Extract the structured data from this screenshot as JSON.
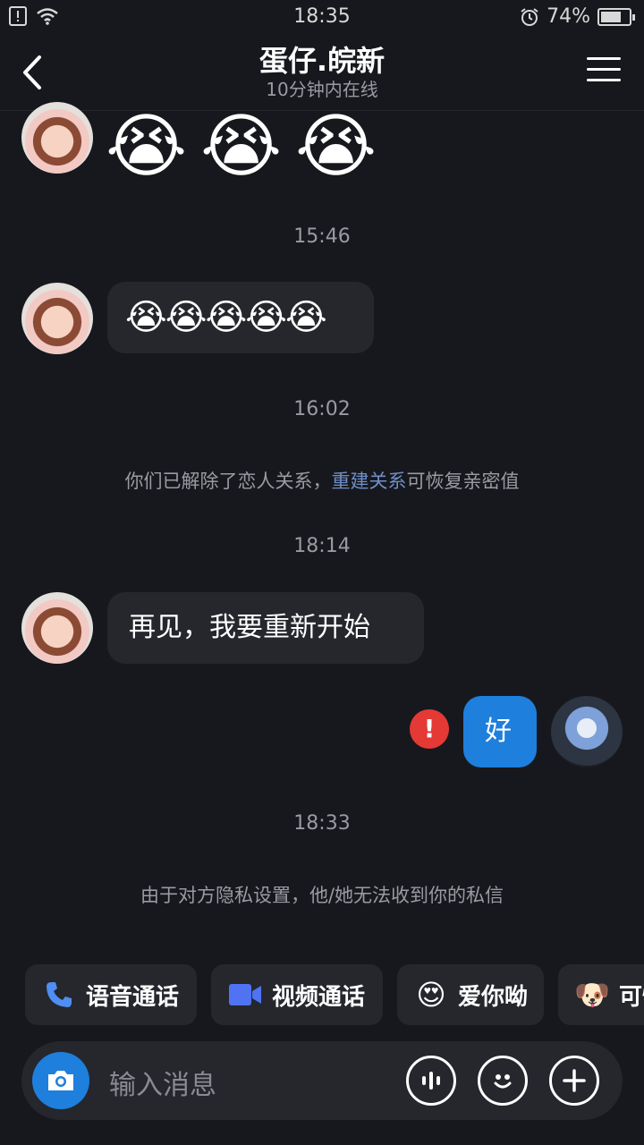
{
  "status_bar": {
    "time": "18:35",
    "battery": "74%",
    "battery_level": 0.74
  },
  "header": {
    "title": "蛋仔.皖新",
    "subtitle": "10分钟内在线"
  },
  "messages": {
    "m1_emoji": [
      "😭",
      "😭",
      "😭"
    ],
    "ts1": "15:46",
    "m2_emoji": "😭😭😭😭😭",
    "ts2": "16:02",
    "sys1_before": "你们已解除了恋人关系，",
    "sys1_link": "重建关系",
    "sys1_after": "可恢复亲密值",
    "ts3": "18:14",
    "m3_text": "再见，我要重新开始",
    "m4_text": "好",
    "error_mark": "!",
    "ts4": "18:33",
    "sys2": "由于对方隐私设置，他/她无法收到你的私信"
  },
  "quick_actions": {
    "voice_call": "语音通话",
    "video_call": "视频通话",
    "love_you": "爱你呦",
    "love_you_emoji": "😍",
    "cute": "可怜",
    "cute_emoji": "🐶"
  },
  "input": {
    "placeholder": "输入消息"
  }
}
